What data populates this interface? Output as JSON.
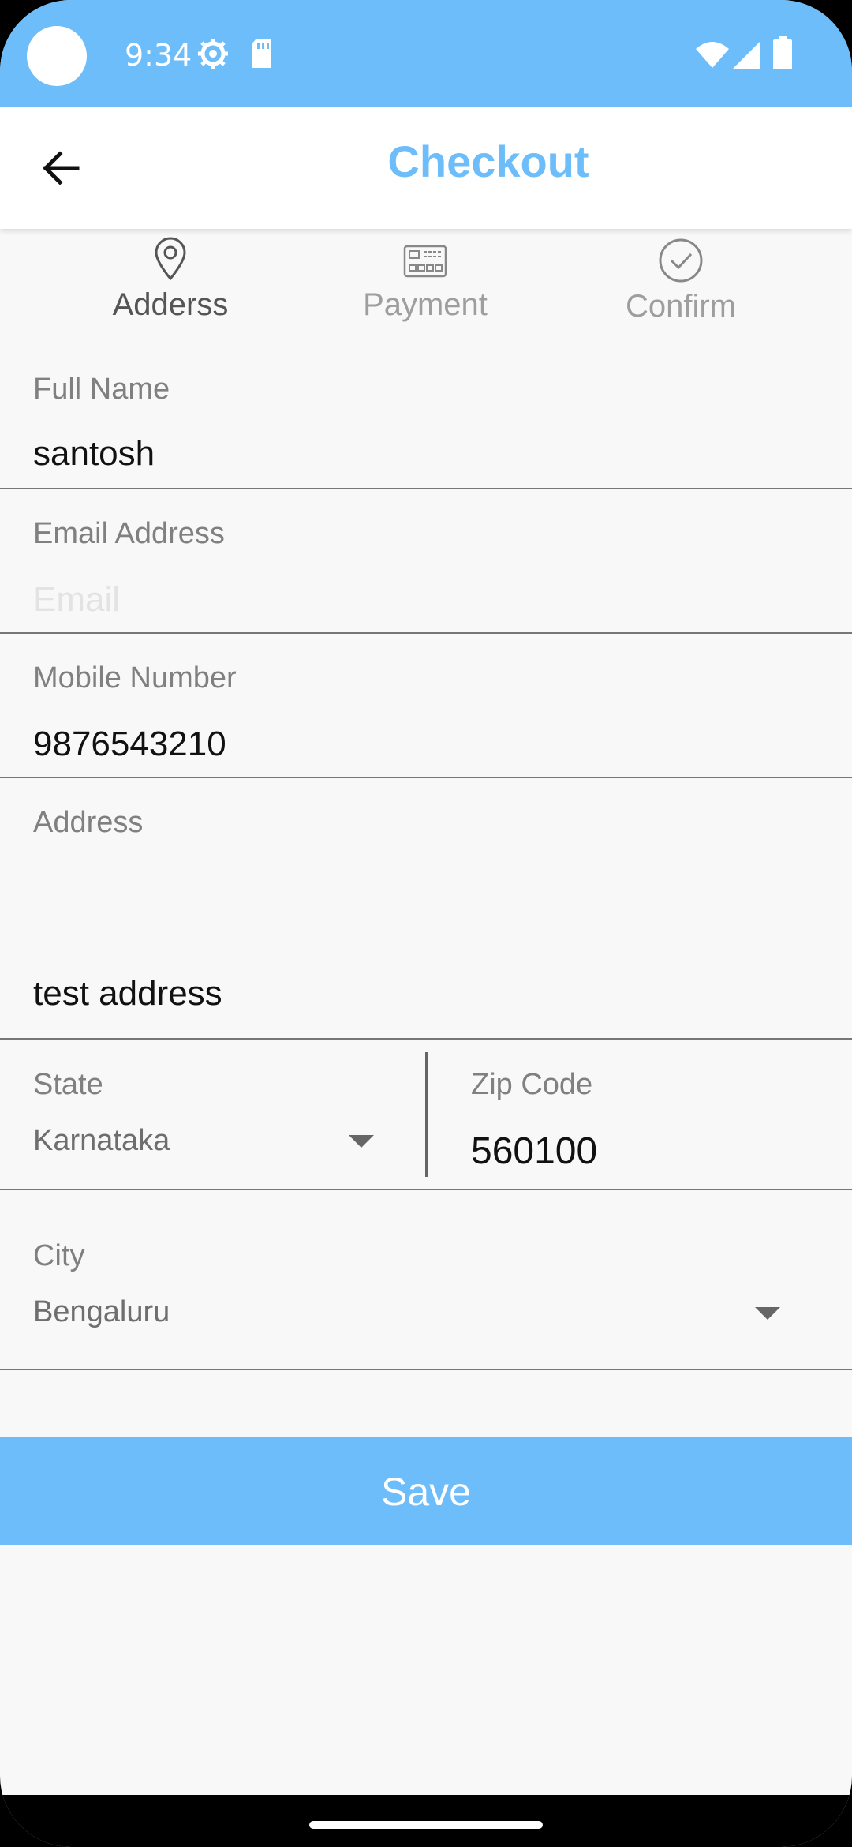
{
  "status_bar": {
    "time": "9:34",
    "icons": [
      "settings-icon",
      "sd-card-icon",
      "wifi-icon",
      "cellular-icon",
      "battery-icon"
    ],
    "background": "#6dbdfa"
  },
  "app_bar": {
    "title": "Checkout",
    "back_icon": "arrow-left-icon",
    "title_color": "#6dbdfa"
  },
  "stepper": [
    {
      "label": "Adderss",
      "icon": "location-pin-icon",
      "active": true
    },
    {
      "label": "Payment",
      "icon": "credit-card-icon",
      "active": false
    },
    {
      "label": "Confirm",
      "icon": "check-circle-icon",
      "active": false
    }
  ],
  "form": {
    "full_name": {
      "label": "Full Name",
      "value": "santosh"
    },
    "email": {
      "label": "Email Address",
      "value": "",
      "placeholder": "Email"
    },
    "mobile": {
      "label": "Mobile Number",
      "value": "9876543210"
    },
    "address": {
      "label": "Address",
      "value": "test address"
    },
    "state": {
      "label": "State",
      "value": "Karnataka"
    },
    "zip": {
      "label": "Zip Code",
      "value": "560100"
    },
    "city": {
      "label": "City",
      "value": "Bengaluru"
    }
  },
  "save_button": {
    "label": "Save",
    "color": "#6dbdfa"
  }
}
